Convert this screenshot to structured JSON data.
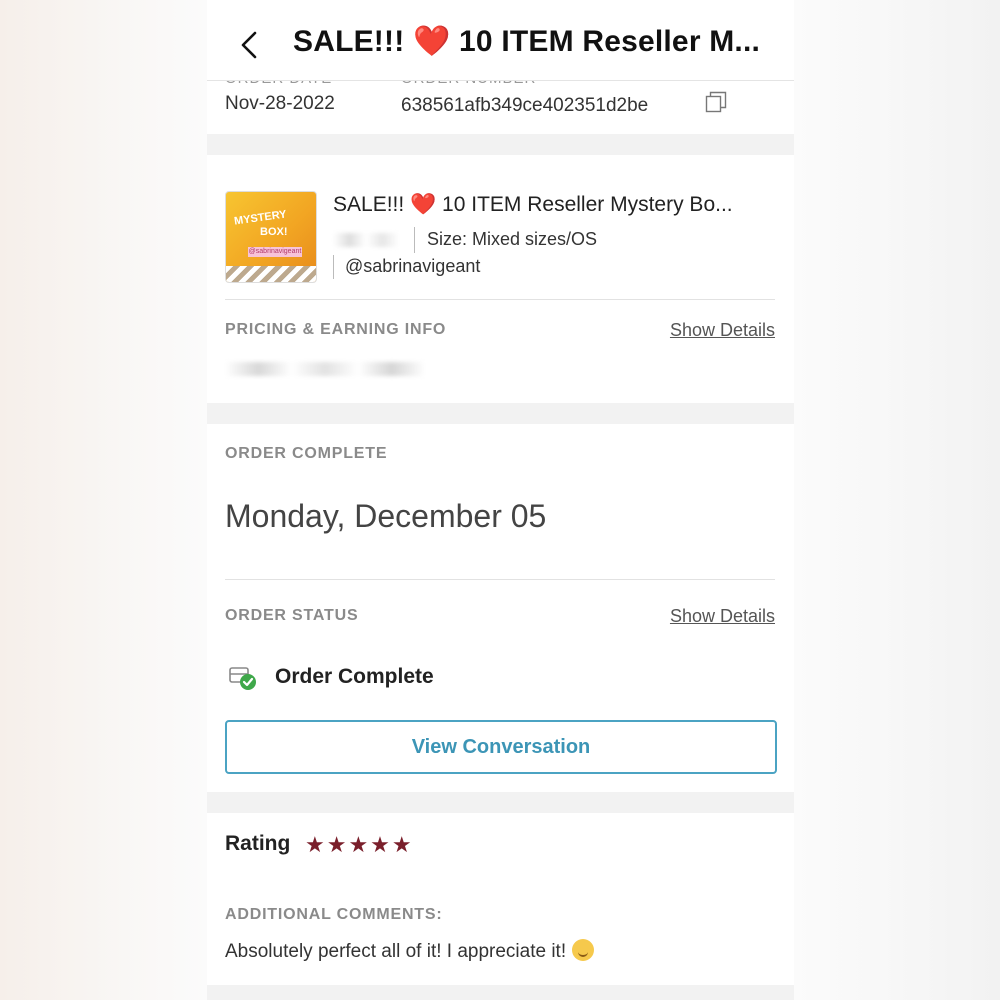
{
  "header": {
    "back_icon": "chevron-left-icon",
    "title_before": "SALE!!!",
    "title_heart": "❤️",
    "title_after": "10 ITEM Reseller M..."
  },
  "order_info": {
    "date_label": "ORDER DATE",
    "date_value": "Nov-28-2022",
    "number_label": "ORDER NUMBER",
    "number_value": "638561afb349ce402351d2be",
    "copy_icon": "copy-icon"
  },
  "product": {
    "thumb_text_1": "MYSTERY",
    "thumb_text_2": "BOX!",
    "thumb_text_3": "@sabrinavigeant",
    "title_before": "SALE!!!",
    "title_heart": "❤️",
    "title_after": "10 ITEM Reseller Mystery Bo...",
    "size": "Size: Mixed sizes/OS",
    "seller": "@sabrinavigeant"
  },
  "pricing": {
    "label": "PRICING & EARNING INFO",
    "link": "Show Details"
  },
  "order_complete": {
    "label": "ORDER COMPLETE",
    "date": "Monday, December 05"
  },
  "order_status": {
    "label": "ORDER STATUS",
    "link": "Show Details",
    "icon": "package-check-icon",
    "status": "Order Complete",
    "button": "View Conversation"
  },
  "rating": {
    "label": "Rating",
    "stars": "★★★★★",
    "stars_value": 5,
    "comments_label": "ADDITIONAL COMMENTS:",
    "comment": "Absolutely perfect all of it! I appreciate it!"
  },
  "colors": {
    "accent": "#3c95b6",
    "star": "#7a1f2b",
    "heart": "#d0182a"
  }
}
